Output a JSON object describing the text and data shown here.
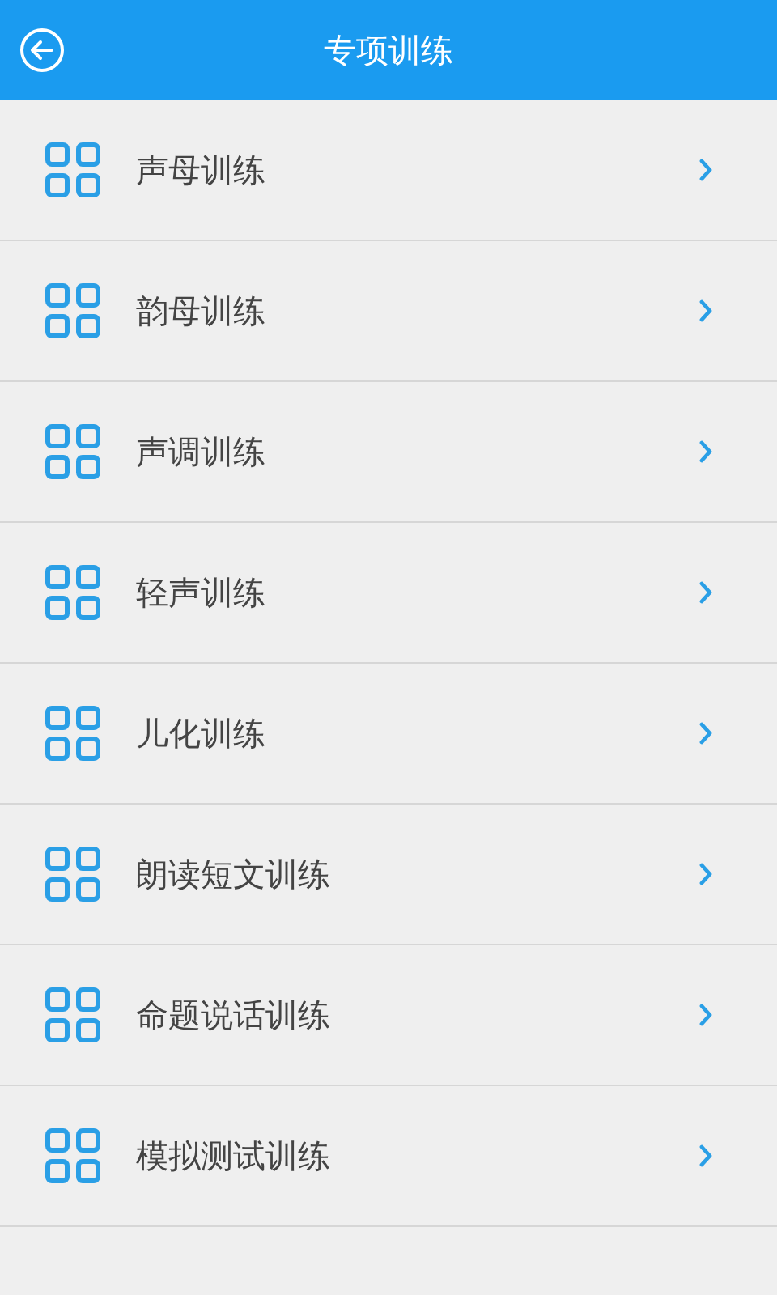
{
  "header": {
    "title": "专项训练"
  },
  "items": [
    {
      "label": "声母训练"
    },
    {
      "label": "韵母训练"
    },
    {
      "label": "声调训练"
    },
    {
      "label": "轻声训练"
    },
    {
      "label": "儿化训练"
    },
    {
      "label": "朗读短文训练"
    },
    {
      "label": "命题说话训练"
    },
    {
      "label": "模拟测试训练"
    }
  ]
}
